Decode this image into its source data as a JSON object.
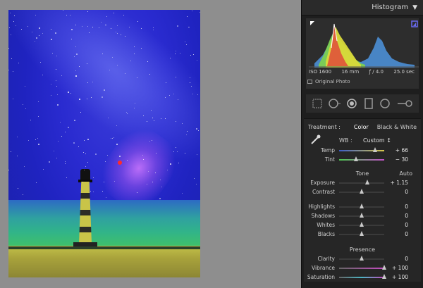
{
  "histogram": {
    "title": "Histogram",
    "iso": "ISO 1600",
    "focal": "16 mm",
    "aperture": "ƒ / 4.0",
    "shutter": "25.0 sec",
    "original_label": "Original Photo"
  },
  "treatment": {
    "label": "Treatment :",
    "color": "Color",
    "bw": "Black & White"
  },
  "wb": {
    "label": "WB :",
    "value": "Custom",
    "arrow": "↕"
  },
  "tone_title": "Tone",
  "auto_label": "Auto",
  "presence_title": "Presence",
  "sliders": {
    "temp": {
      "label": "Temp",
      "value": "+ 66",
      "pos": 0.8
    },
    "tint": {
      "label": "Tint",
      "value": "− 30",
      "pos": 0.38
    },
    "exposure": {
      "label": "Exposure",
      "value": "+ 1.15",
      "pos": 0.62
    },
    "contrast": {
      "label": "Contrast",
      "value": "0",
      "pos": 0.5
    },
    "highlights": {
      "label": "Highlights",
      "value": "0",
      "pos": 0.5
    },
    "shadows": {
      "label": "Shadows",
      "value": "0",
      "pos": 0.5
    },
    "whites": {
      "label": "Whites",
      "value": "0",
      "pos": 0.5
    },
    "blacks": {
      "label": "Blacks",
      "value": "0",
      "pos": 0.5
    },
    "clarity": {
      "label": "Clarity",
      "value": "0",
      "pos": 0.5
    },
    "vibrance": {
      "label": "Vibrance",
      "value": "+ 100",
      "pos": 1.0
    },
    "saturation": {
      "label": "Saturation",
      "value": "+ 100",
      "pos": 1.0
    }
  }
}
